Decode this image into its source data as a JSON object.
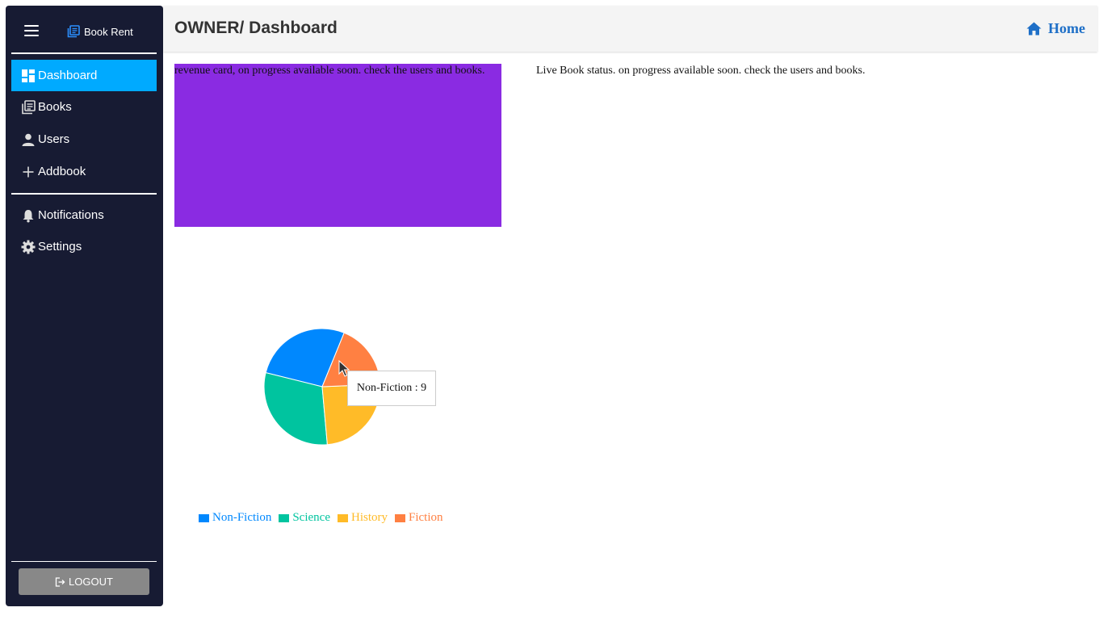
{
  "sidebar": {
    "brand": "Book Rent",
    "nav": [
      {
        "label": "Dashboard",
        "icon": "dashboard-icon",
        "active": true
      },
      {
        "label": "Books",
        "icon": "books-icon"
      },
      {
        "label": "Users",
        "icon": "user-icon"
      },
      {
        "label": "Addbook",
        "icon": "plus-icon"
      }
    ],
    "secondary": [
      {
        "label": "Notifications",
        "icon": "bell-icon"
      },
      {
        "label": "Settings",
        "icon": "gear-icon"
      }
    ],
    "logout_label": "LOGOUT"
  },
  "header": {
    "title": "OWNER/ Dashboard",
    "home_label": "Home"
  },
  "main": {
    "revenue_card_text": "revenue card, on progress available soon. check the users and books.",
    "live_status_text": "Live Book status. on progress available soon. check the users and books."
  },
  "tooltip": {
    "text": "Non-Fiction : 9"
  },
  "colors": {
    "sidebar_bg": "#171b33",
    "active_nav": "#00aaff",
    "revenue_card": "#8a2be2",
    "home_link": "#1e6fc7",
    "logout_button": "#888888"
  },
  "chart_data": {
    "type": "pie",
    "categories": [
      "Non-Fiction",
      "Science",
      "History",
      "Fiction"
    ],
    "values": [
      9,
      10,
      8,
      6
    ],
    "colors": [
      "#0088fe",
      "#00c49f",
      "#ffbb28",
      "#ff8042"
    ],
    "legend_position": "bottom"
  }
}
